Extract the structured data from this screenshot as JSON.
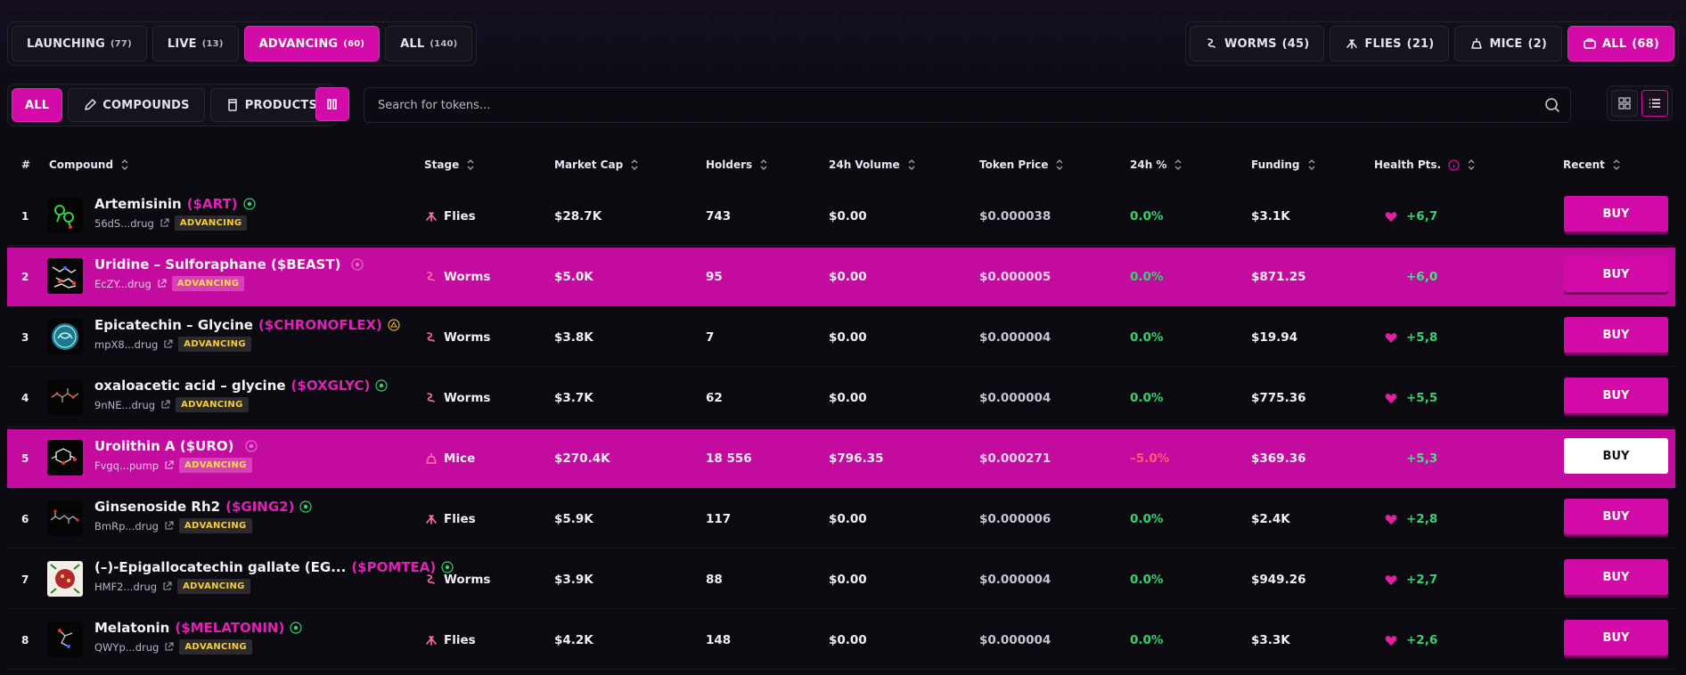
{
  "stage_tabs": [
    {
      "label": "LAUNCHING",
      "count": "(77)",
      "active": false
    },
    {
      "label": "LIVE",
      "count": "(13)",
      "active": false
    },
    {
      "label": "ADVANCING",
      "count": "(60)",
      "active": true
    },
    {
      "label": "ALL",
      "count": "(140)",
      "active": false
    }
  ],
  "animal_tabs": [
    {
      "label": "WORMS",
      "count": "(45)",
      "icon": "worm-icon",
      "active": false
    },
    {
      "label": "FLIES",
      "count": "(21)",
      "icon": "fly-icon",
      "active": false
    },
    {
      "label": "MICE",
      "count": "(2)",
      "icon": "mouse-icon",
      "active": false
    },
    {
      "label": "ALL",
      "count": "(68)",
      "icon": "box-icon",
      "active": true
    }
  ],
  "category_tabs": [
    {
      "label": "ALL",
      "icon": "",
      "active": true
    },
    {
      "label": "COMPOUNDS",
      "icon": "pencil-icon",
      "active": false
    },
    {
      "label": "PRODUCTS",
      "icon": "bottle-icon",
      "active": false
    }
  ],
  "search": {
    "placeholder": "Search for tokens..."
  },
  "columns": {
    "num": "#",
    "compound": "Compound",
    "stage": "Stage",
    "market_cap": "Market Cap",
    "holders": "Holders",
    "volume": "24h Volume",
    "price": "Token Price",
    "change": "24h %",
    "funding": "Funding",
    "health": "Health Pts.",
    "recent": "Recent"
  },
  "buy_label": "BUY",
  "badge_label": "ADVANCING",
  "rows": [
    {
      "num": "1",
      "name": "Artemisinin",
      "ticker": "($ART)",
      "addr": "56dS...drug",
      "stage": "Flies",
      "market_cap": "$28.7K",
      "holders": "743",
      "volume": "$0.00",
      "price": "$0.000038",
      "change": "0.0%",
      "funding": "$3.1K",
      "health": "+6,7"
    },
    {
      "num": "2",
      "name": "Uridine – Sulforaphane ($BEAST)",
      "ticker": "",
      "addr": "EcZY...drug",
      "stage": "Worms",
      "market_cap": "$5.0K",
      "holders": "95",
      "volume": "$0.00",
      "price": "$0.000005",
      "change": "0.0%",
      "funding": "$871.25",
      "health": "+6,0"
    },
    {
      "num": "3",
      "name": "Epicatechin – Glycine",
      "ticker": "($CHRONOFLEX)",
      "addr": "mpX8...drug",
      "stage": "Worms",
      "market_cap": "$3.8K",
      "holders": "7",
      "volume": "$0.00",
      "price": "$0.000004",
      "change": "0.0%",
      "funding": "$19.94",
      "health": "+5,8"
    },
    {
      "num": "4",
      "name": "oxaloacetic acid – glycine",
      "ticker": "($OXGLYC)",
      "addr": "9nNE...drug",
      "stage": "Worms",
      "market_cap": "$3.7K",
      "holders": "62",
      "volume": "$0.00",
      "price": "$0.000004",
      "change": "0.0%",
      "funding": "$775.36",
      "health": "+5,5"
    },
    {
      "num": "5",
      "name": "Urolithin A ($URO)",
      "ticker": "",
      "addr": "Fvgq...pump",
      "stage": "Mice",
      "market_cap": "$270.4K",
      "holders": "18 556",
      "volume": "$796.35",
      "price": "$0.000271",
      "change": "–5.0%",
      "funding": "$369.36",
      "health": "+5,3"
    },
    {
      "num": "6",
      "name": "Ginsenoside Rh2",
      "ticker": "($GING2)",
      "addr": "BmRp...drug",
      "stage": "Flies",
      "market_cap": "$5.9K",
      "holders": "117",
      "volume": "$0.00",
      "price": "$0.000006",
      "change": "0.0%",
      "funding": "$2.4K",
      "health": "+2,8"
    },
    {
      "num": "7",
      "name": "(–)-Epigallocatechin gallate (EG...",
      "ticker": "($POMTEA)",
      "addr": "HMF2...drug",
      "stage": "Worms",
      "market_cap": "$3.9K",
      "holders": "88",
      "volume": "$0.00",
      "price": "$0.000004",
      "change": "0.0%",
      "funding": "$949.26",
      "health": "+2,7"
    },
    {
      "num": "8",
      "name": "Melatonin",
      "ticker": "($MELATONIN)",
      "addr": "QWYp...drug",
      "stage": "Flies",
      "market_cap": "$4.2K",
      "holders": "148",
      "volume": "$0.00",
      "price": "$0.000004",
      "change": "0.0%",
      "funding": "$3.3K",
      "health": "+2,6"
    }
  ],
  "colors": {
    "accent": "#d20aa8",
    "highlight_row": "#c30b9f",
    "positive": "#36d270",
    "negative": "#ff5a75",
    "badge_text": "#f5cf37"
  }
}
